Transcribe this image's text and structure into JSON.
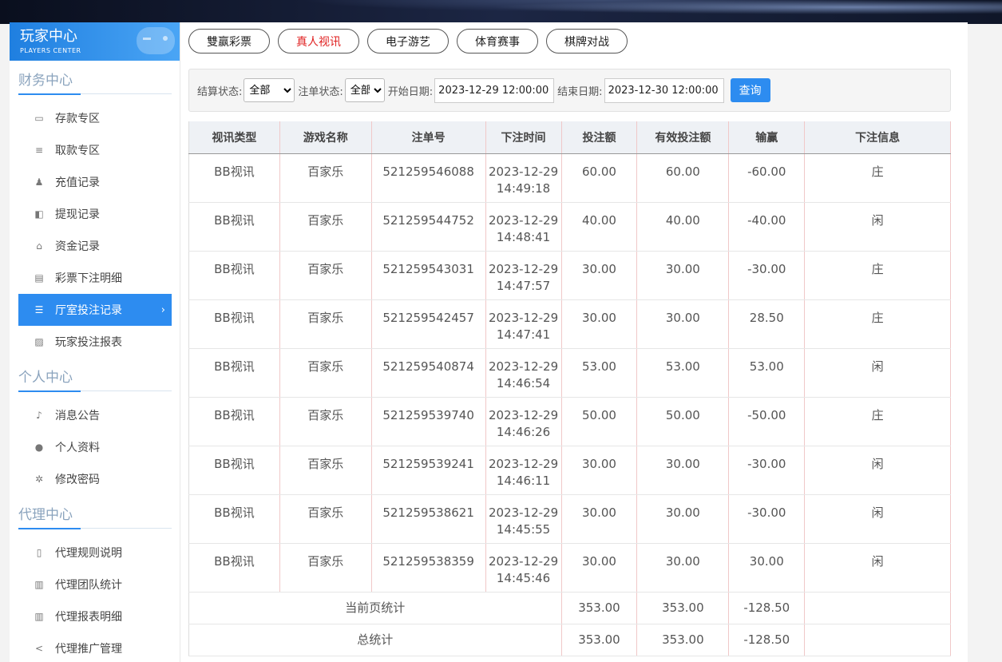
{
  "brand": {
    "title": "玩家中心",
    "subtitle": "PLAYERS CENTER"
  },
  "sidebar": {
    "sections": [
      {
        "title": "财务中心",
        "items": [
          {
            "label": "存款专区",
            "icon": "card-icon",
            "glyph": "▭"
          },
          {
            "label": "取款专区",
            "icon": "cash-icon",
            "glyph": "≡"
          },
          {
            "label": "充值记录",
            "icon": "moneybag-icon",
            "glyph": "♟"
          },
          {
            "label": "提现记录",
            "icon": "wallet-icon",
            "glyph": "◧"
          },
          {
            "label": "资金记录",
            "icon": "bank-icon",
            "glyph": "⌂"
          },
          {
            "label": "彩票下注明细",
            "icon": "list-icon",
            "glyph": "▤"
          },
          {
            "label": "厅室投注记录",
            "icon": "records-icon",
            "glyph": "☰",
            "active": true
          },
          {
            "label": "玩家投注报表",
            "icon": "image-icon",
            "glyph": "▨"
          }
        ]
      },
      {
        "title": "个人中心",
        "items": [
          {
            "label": "消息公告",
            "icon": "bell-icon",
            "glyph": "♪"
          },
          {
            "label": "个人资料",
            "icon": "user-icon",
            "glyph": "●"
          },
          {
            "label": "修改密码",
            "icon": "gear-icon",
            "glyph": "✲"
          }
        ]
      },
      {
        "title": "代理中心",
        "items": [
          {
            "label": "代理规则说明",
            "icon": "document-icon",
            "glyph": "▯"
          },
          {
            "label": "代理团队统计",
            "icon": "book-icon",
            "glyph": "▥"
          },
          {
            "label": "代理报表明细",
            "icon": "report-icon",
            "glyph": "▥"
          },
          {
            "label": "代理推广管理",
            "icon": "share-icon",
            "glyph": "<"
          }
        ]
      }
    ]
  },
  "tabs": [
    {
      "label": "雙赢彩票"
    },
    {
      "label": "真人视讯",
      "active": true
    },
    {
      "label": "电子游艺"
    },
    {
      "label": "体育赛事"
    },
    {
      "label": "棋牌对战"
    }
  ],
  "filter": {
    "settle_label": "结算状态:",
    "settle_value": "全部",
    "bet_label": "注单状态:",
    "bet_value": "全部",
    "start_label": "开始日期:",
    "start_value": "2023-12-29 12:00:00",
    "end_label": "结束日期:",
    "end_value": "2023-12-30 12:00:00",
    "query_label": "查询"
  },
  "table": {
    "headers": [
      "视讯类型",
      "游戏名称",
      "注单号",
      "下注时间",
      "投注额",
      "有效投注额",
      "输赢",
      "下注信息"
    ],
    "rows": [
      {
        "type": "BB视讯",
        "game": "百家乐",
        "id": "521259546088",
        "date": "2023-12-29",
        "time": "14:49:18",
        "bet": "60.00",
        "valid": "60.00",
        "win": "-60.00",
        "info": "庄"
      },
      {
        "type": "BB视讯",
        "game": "百家乐",
        "id": "521259544752",
        "date": "2023-12-29",
        "time": "14:48:41",
        "bet": "40.00",
        "valid": "40.00",
        "win": "-40.00",
        "info": "闲"
      },
      {
        "type": "BB视讯",
        "game": "百家乐",
        "id": "521259543031",
        "date": "2023-12-29",
        "time": "14:47:57",
        "bet": "30.00",
        "valid": "30.00",
        "win": "-30.00",
        "info": "庄"
      },
      {
        "type": "BB视讯",
        "game": "百家乐",
        "id": "521259542457",
        "date": "2023-12-29",
        "time": "14:47:41",
        "bet": "30.00",
        "valid": "30.00",
        "win": "28.50",
        "info": "庄"
      },
      {
        "type": "BB视讯",
        "game": "百家乐",
        "id": "521259540874",
        "date": "2023-12-29",
        "time": "14:46:54",
        "bet": "53.00",
        "valid": "53.00",
        "win": "53.00",
        "info": "闲"
      },
      {
        "type": "BB视讯",
        "game": "百家乐",
        "id": "521259539740",
        "date": "2023-12-29",
        "time": "14:46:26",
        "bet": "50.00",
        "valid": "50.00",
        "win": "-50.00",
        "info": "庄"
      },
      {
        "type": "BB视讯",
        "game": "百家乐",
        "id": "521259539241",
        "date": "2023-12-29",
        "time": "14:46:11",
        "bet": "30.00",
        "valid": "30.00",
        "win": "-30.00",
        "info": "闲"
      },
      {
        "type": "BB视讯",
        "game": "百家乐",
        "id": "521259538621",
        "date": "2023-12-29",
        "time": "14:45:55",
        "bet": "30.00",
        "valid": "30.00",
        "win": "-30.00",
        "info": "闲"
      },
      {
        "type": "BB视讯",
        "game": "百家乐",
        "id": "521259538359",
        "date": "2023-12-29",
        "time": "14:45:46",
        "bet": "30.00",
        "valid": "30.00",
        "win": "30.00",
        "info": "闲"
      }
    ],
    "summary": [
      {
        "label": "当前页统计",
        "bet": "353.00",
        "valid": "353.00",
        "win": "-128.50"
      },
      {
        "label": "总统计",
        "bet": "353.00",
        "valid": "353.00",
        "win": "-128.50"
      }
    ]
  }
}
